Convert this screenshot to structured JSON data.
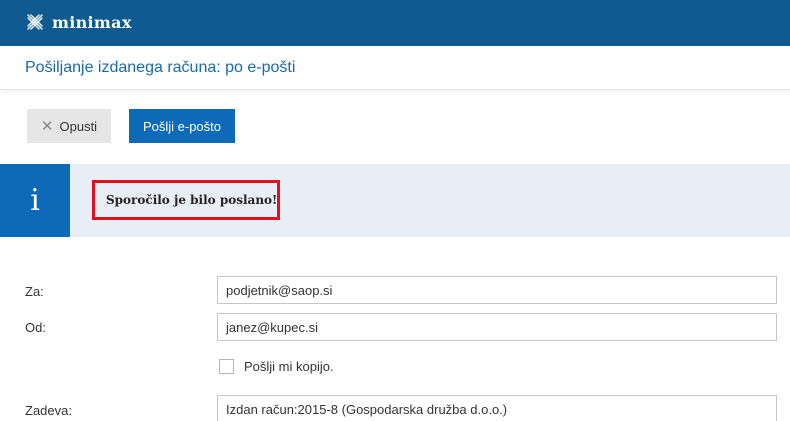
{
  "app": {
    "name": "minimax",
    "brand_color": "#0e5a91"
  },
  "page": {
    "title": "Pošiljanje izdanega računa: po e-pošti"
  },
  "toolbar": {
    "cancel_label": "Opusti",
    "cancel_icon": "close-icon",
    "send_label": "Pošlji e-pošto",
    "send_color": "#0d6ab8"
  },
  "alert": {
    "icon": "info-icon",
    "icon_glyph": "i",
    "message": "Sporočilo je bilo poslano!",
    "highlight_color": "#e2101d"
  },
  "form": {
    "to_label": "Za:",
    "to_value": "podjetnik@saop.si",
    "from_label": "Od:",
    "from_value": "janez@kupec.si",
    "copy_label": "Pošlji mi kopijo.",
    "copy_checked": false,
    "subject_label": "Zadeva:",
    "subject_value": "Izdan račun:2015-8 (Gospodarska družba d.o.o.)"
  }
}
